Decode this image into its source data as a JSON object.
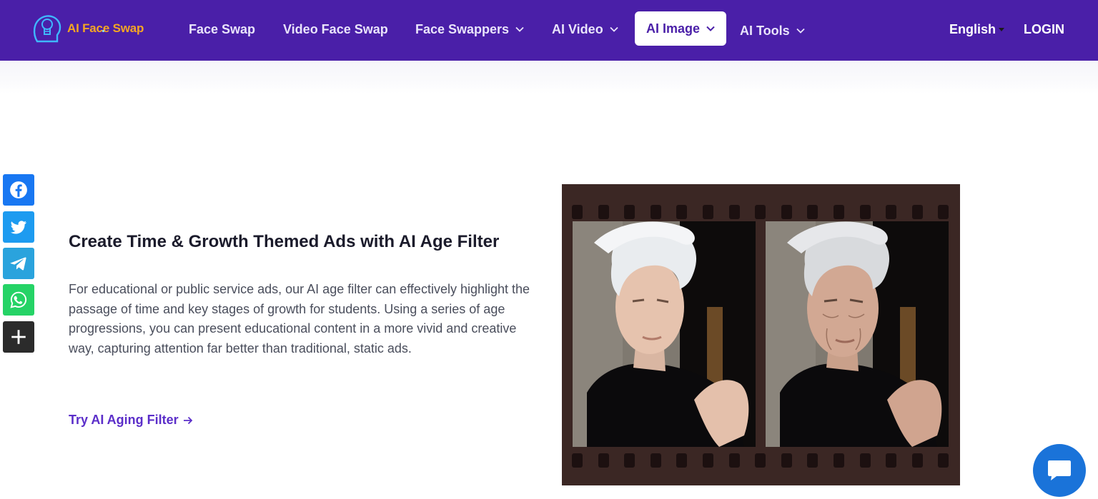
{
  "header": {
    "logo_text": "AI Face Swap",
    "nav": [
      {
        "label": "Face Swap",
        "dropdown": false
      },
      {
        "label": "Video Face Swap",
        "dropdown": false
      },
      {
        "label": "Face Swappers",
        "dropdown": true
      },
      {
        "label": "AI Video",
        "dropdown": true
      },
      {
        "label": "AI Image",
        "dropdown": true,
        "active": true
      },
      {
        "label": "AI Tools",
        "dropdown": true
      }
    ],
    "language": "English",
    "login": "LOGIN"
  },
  "share_bar": [
    {
      "name": "facebook",
      "color": "#1877f2",
      "icon": "facebook-icon"
    },
    {
      "name": "twitter",
      "color": "#1d9bf0",
      "icon": "twitter-icon"
    },
    {
      "name": "telegram",
      "color": "#2aa3dd",
      "icon": "telegram-icon"
    },
    {
      "name": "whatsapp",
      "color": "#25d366",
      "icon": "whatsapp-icon"
    },
    {
      "name": "more",
      "color": "#2b2b2b",
      "icon": "plus-icon"
    }
  ],
  "feature": {
    "title": "Create Time & Growth Themed Ads with AI Age Filter",
    "description": "For educational or public service ads, our AI age filter can effectively highlight the passage of time and key stages of growth for students. Using a series of age progressions, you can present educational content in a more vivid and creative way, capturing attention far better than traditional, static ads.",
    "cta": "Try AI Aging Filter"
  },
  "image": {
    "frames": [
      "young-portrait",
      "aged-portrait"
    ]
  },
  "colors": {
    "nav_bg": "#4a1fa8",
    "accent": "#5b2ec9",
    "logo_orange": "#f5a623",
    "chat_blue": "#1a73d9",
    "film_brown": "#3b2724"
  }
}
